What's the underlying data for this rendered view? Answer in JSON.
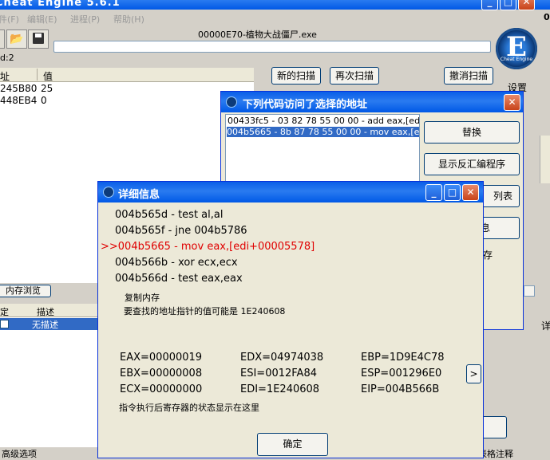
{
  "main": {
    "title": "Cheat Engine 5.6.1",
    "menu": [
      "件(F)",
      "编辑(E)",
      "进程(P)",
      "帮助(H)"
    ],
    "process_name": "00000E70-植物大战僵尸.exe",
    "found_label": "d:2",
    "col_address": "址",
    "col_value": "值",
    "rows": [
      {
        "address": "245B80",
        "value": "25"
      },
      {
        "address": "448EB4",
        "value": "0"
      }
    ],
    "btn_new_scan": "新的扫描",
    "btn_next_scan": "再次扫描",
    "btn_undo_scan": "撤消扫描",
    "settings_label": "设置",
    "logo_text": "Cheat Engine",
    "memory_browse": "内存浏览",
    "col_frozen": "定",
    "col_desc": "描述",
    "list_row_desc": "无描述",
    "advanced_options": "高级选项",
    "right_digit": "0",
    "right_fragment": "详",
    "comment_fragment": "表格注释"
  },
  "code_window": {
    "title": "下列代码访问了选择的地址",
    "items": [
      "00433fc5 - 03 82 78 55 00 00 - add eax,[edx+0000",
      "004b5665 - 8b 87 78 55 00 00 - mov eax,[edi+0000"
    ],
    "btn_replace": "替换",
    "btn_disasm": "显示反汇编程序",
    "btn_list_frag": "列表",
    "btn_info_frag": "息",
    "side_frag": "存"
  },
  "detail": {
    "title": "详细信息",
    "code_lines": [
      {
        "text": "004b565d - test al,al",
        "highlight": false
      },
      {
        "text": "004b565f - jne 004b5786",
        "highlight": false
      },
      {
        "text": ">>004b5665 - mov eax,[edi+00005578]",
        "highlight": true
      },
      {
        "text": "004b566b - xor ecx,ecx",
        "highlight": false
      },
      {
        "text": "004b566d - test eax,eax",
        "highlight": false
      }
    ],
    "copy_memory": "复制内存",
    "pointer_hint": "要查找的地址指针的值可能是 1E240608",
    "registers": [
      [
        "EAX=00000019",
        "EDX=04974038",
        "EBP=1D9E4C78"
      ],
      [
        "EBX=00000008",
        "ESI=0012FA84",
        "ESP=001296E0"
      ],
      [
        "ECX=00000000",
        "EDI=1E240608",
        "EIP=004B566B"
      ]
    ],
    "reg_note": "指令执行后寄存器的状态显示在这里",
    "expand_label": ">",
    "btn_ok": "确定",
    "color_highlight": "#e00000"
  }
}
